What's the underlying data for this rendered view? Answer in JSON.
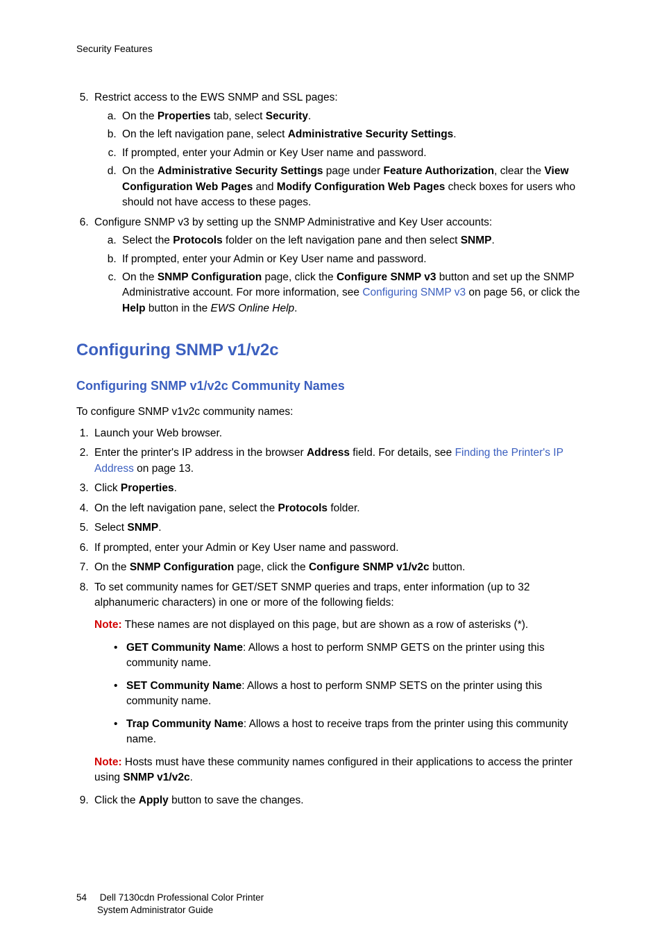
{
  "header": "Security Features",
  "item5": {
    "num": "5.",
    "text": "Restrict access to the EWS SNMP and SSL pages:",
    "a_pre": "On the ",
    "a_b1": "Properties",
    "a_mid": " tab, select ",
    "a_b2": "Security",
    "a_post": ".",
    "b_pre": "On the left navigation pane, select ",
    "b_b1": "Administrative Security Settings",
    "b_post": ".",
    "c": "If prompted, enter your Admin or Key User name and password.",
    "d_pre": "On the ",
    "d_b1": "Administrative Security Settings",
    "d_mid1": " page under ",
    "d_b2": "Feature Authorization",
    "d_mid2": ", clear the ",
    "d_b3": "View Configuration Web Pages",
    "d_mid3": " and ",
    "d_b4": "Modify Configuration Web Pages",
    "d_post": " check boxes for users who should not have access to these pages."
  },
  "item6": {
    "num": "6.",
    "text": "Configure SNMP v3 by setting up the SNMP Administrative and Key User accounts:",
    "a_pre": "Select the ",
    "a_b1": "Protocols",
    "a_mid": " folder on the left navigation pane and then select ",
    "a_b2": "SNMP",
    "a_post": ".",
    "b": "If prompted, enter your Admin or Key User name and password.",
    "c_pre": "On the ",
    "c_b1": "SNMP Configuration",
    "c_mid1": " page, click the ",
    "c_b2": "Configure SNMP v3",
    "c_mid2": " button and set up the SNMP Administrative account. For more information, see ",
    "c_link": "Configuring SNMP v3",
    "c_mid3": " on page 56, or click the ",
    "c_b3": "Help",
    "c_mid4": " button in the ",
    "c_i1": "EWS Online Help",
    "c_post": "."
  },
  "h2": "Configuring SNMP v1/v2c",
  "h3": "Configuring SNMP v1/v2c Community Names",
  "intro": "To configure SNMP v1v2c community names:",
  "steps": {
    "s1": "Launch your Web browser.",
    "s2_pre": "Enter the printer's IP address in the browser ",
    "s2_b1": "Address",
    "s2_mid": " field. For details, see ",
    "s2_link": "Finding the Printer's IP Address",
    "s2_post": " on page 13.",
    "s3_pre": "Click ",
    "s3_b1": "Properties",
    "s3_post": ".",
    "s4_pre": "On the left navigation pane, select the ",
    "s4_b1": "Protocols",
    "s4_post": " folder.",
    "s5_pre": "Select ",
    "s5_b1": "SNMP",
    "s5_post": ".",
    "s6": "If prompted, enter your Admin or Key User name and password.",
    "s7_pre": "On the ",
    "s7_b1": "SNMP Configuration",
    "s7_mid": " page, click the ",
    "s7_b2": "Configure SNMP v1/v2c",
    "s7_post": " button.",
    "s8": "To set community names for GET/SET SNMP queries and traps, enter information (up to 32 alphanumeric characters) in one or more of the following fields:",
    "note1_label": "Note:",
    "note1": " These names are not displayed on this page, but are shown as a row of asterisks (*).",
    "b1_b": "GET Community Name",
    "b1": ": Allows a host to perform SNMP GETS on the printer using this community name.",
    "b2_b": "SET Community Name",
    "b2": ": Allows a host to perform SNMP SETS on the printer using this community name.",
    "b3_b": "Trap Community Name",
    "b3": ": Allows a host to receive traps from the printer using this community name.",
    "note2_label": "Note:",
    "note2_pre": " Hosts must have these community names configured in their applications to access the printer using ",
    "note2_b": "SNMP v1/v2c",
    "note2_post": ".",
    "s9_pre": "Click the ",
    "s9_b1": "Apply",
    "s9_post": " button to save the changes."
  },
  "footer": {
    "page": "54",
    "line1": "Dell 7130cdn Professional Color Printer",
    "line2": "System Administrator Guide"
  }
}
